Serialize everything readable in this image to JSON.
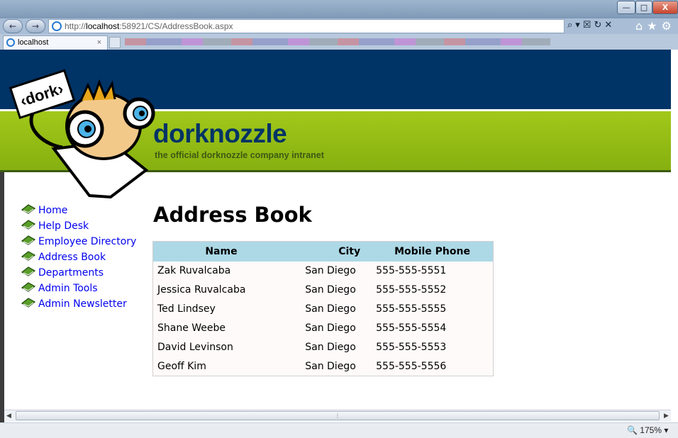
{
  "browser": {
    "url_prefix": "http://",
    "url_host": "localhost",
    "url_rest": ":58921/CS/AddressBook.aspx",
    "tab_title": "localhost",
    "tab_close": "×",
    "zoom": "175%",
    "minimize": "—",
    "maximize": "□",
    "close": "X",
    "back": "←",
    "forward": "→",
    "address_tools": "⌕▾☒↻✕",
    "home_tools": "⌂★⚙"
  },
  "site": {
    "brand": "dorknozzle",
    "tagline": "the official dorknozzle company intranet",
    "logo_sign": "‹dork›"
  },
  "nav": {
    "items": [
      {
        "label": "Home"
      },
      {
        "label": "Help Desk"
      },
      {
        "label": "Employee Directory"
      },
      {
        "label": "Address Book"
      },
      {
        "label": "Departments"
      },
      {
        "label": "Admin Tools"
      },
      {
        "label": "Admin Newsletter"
      }
    ]
  },
  "page": {
    "title": "Address Book",
    "columns": [
      "Name",
      "City",
      "Mobile Phone"
    ],
    "rows": [
      {
        "name": "Zak Ruvalcaba",
        "city": "San Diego",
        "phone": "555-555-5551"
      },
      {
        "name": "Jessica Ruvalcaba",
        "city": "San Diego",
        "phone": "555-555-5552"
      },
      {
        "name": "Ted Lindsey",
        "city": "San Diego",
        "phone": "555-555-5555"
      },
      {
        "name": "Shane Weebe",
        "city": "San Diego",
        "phone": "555-555-5554"
      },
      {
        "name": "David Levinson",
        "city": "San Diego",
        "phone": "555-555-5553"
      },
      {
        "name": "Geoff Kim",
        "city": "San Diego",
        "phone": "555-555-5556"
      }
    ]
  },
  "colors": {
    "header_blue": "#003366",
    "header_green": "#95bd15",
    "table_header": "#add8e6",
    "link": "#0000ee"
  }
}
